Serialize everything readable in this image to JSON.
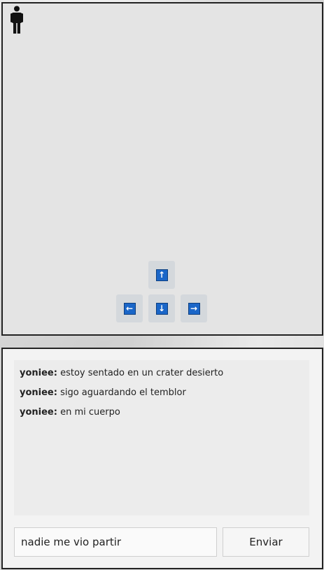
{
  "game": {
    "avatar_icon": "person-icon",
    "controls": {
      "up": "↑",
      "left": "←",
      "down": "↓",
      "right": "→"
    }
  },
  "chat": {
    "messages": [
      {
        "user": "yoniee:",
        "text": " estoy sentado en un crater desierto"
      },
      {
        "user": "yoniee:",
        "text": " sigo aguardando el temblor"
      },
      {
        "user": "yoniee:",
        "text": " en mi cuerpo"
      }
    ],
    "input_value": "nadie me vio partir",
    "send_label": "Enviar"
  },
  "colors": {
    "arrow_accent": "#1a66c8",
    "panel_border": "#222222"
  }
}
